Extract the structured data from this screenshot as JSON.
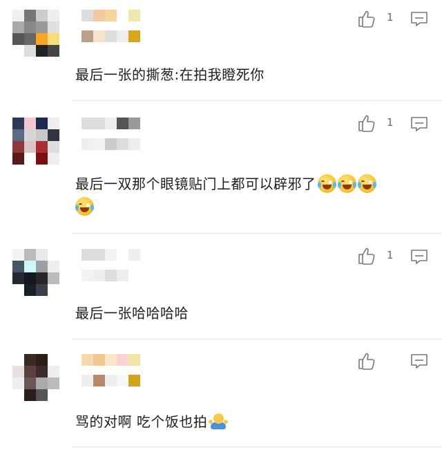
{
  "comments": [
    {
      "text": "最后一张的撕葱:在拍我瞪死你",
      "emoji": [],
      "like_count": "1",
      "like_icon": "thumbs-up-icon",
      "reply_icon": "comment-icon",
      "avatar_colors": [
        "#f0f0f0",
        "#777",
        "#ccc",
        "#eee",
        "#aaa",
        "#888",
        "#999",
        "#e0e0e0",
        "#555",
        "#666",
        "#f5a623",
        "#f9dd7a",
        "#fff",
        "#ddd",
        "#222",
        "#444"
      ],
      "username_colors": [
        "#ddd",
        "#f4c9a1",
        "#f6d49c",
        "#fff",
        "#f1e7a8",
        "#b8a08a",
        "#f7e3c9",
        "#ddd",
        "#eee",
        "#d9a51a"
      ]
    },
    {
      "text": "最后一双那个眼镜贴门上都可以辟邪了",
      "emoji": [
        "laugh-cry-emoji",
        "laugh-cry-emoji",
        "laugh-cry-emoji",
        "laugh-cry-emoji"
      ],
      "like_count": "1",
      "like_icon": "thumbs-up-icon",
      "reply_icon": "comment-icon",
      "avatar_colors": [
        "#2b3a55",
        "#f3c7cf",
        "#1c2b4d",
        "#eee",
        "#5a6b82",
        "#d6d6d6",
        "#c8c8c8",
        "#2e3640",
        "#8c3a3a",
        "#d9c7c7",
        "#a83030",
        "#ddd",
        "#5a1a1a",
        "#fff",
        "#7a1010",
        "#eee"
      ],
      "username_colors": [
        "#ddd",
        "#ddd",
        "#eee",
        "#555",
        "#999",
        "#eee",
        "#f2f2f2",
        "#ccc",
        "#ddd",
        "#eee"
      ]
    },
    {
      "text": "最后一张哈哈哈哈",
      "emoji": [],
      "like_count": "1",
      "like_icon": "thumbs-up-icon",
      "reply_icon": "comment-icon",
      "avatar_colors": [
        "#f4f4f4",
        "#bbb",
        "#e8e8e8",
        "#fff",
        "#456",
        "#cef7f7",
        "#9aa0a6",
        "#eee",
        "#222a33",
        "#111820",
        "#2b2626",
        "#bbb",
        "#fff",
        "#1a1f26",
        "#3a3f48",
        "#fff"
      ],
      "username_colors": [
        "#ddd",
        "#ddd",
        "#f3f3f3",
        "#fff",
        "#eee",
        "#f3f3f3",
        "#eee",
        "#ddd",
        "#eee",
        "#fff"
      ]
    },
    {
      "text": "骂的对啊 吃个饭也拍",
      "emoji": [
        "shrug-emoji"
      ],
      "like_count": "",
      "like_icon": "thumbs-up-icon",
      "reply_icon": "comment-icon",
      "avatar_colors": [
        "#fff",
        "#3a2a22",
        "#2e1e1a",
        "#fff",
        "#e6e0e0",
        "#5a4040",
        "#3d2a2a",
        "#eee",
        "#eee",
        "#6b5555",
        "#aaa",
        "#bbb",
        "#fff",
        "#2a1e1e",
        "#555",
        "#fff"
      ],
      "username_colors": [
        "#f7d9b0",
        "#f2c78f",
        "#f9e5c7",
        "#f9d4d4",
        "#f3e3a5",
        "#eee",
        "#b88a6a",
        "#eee",
        "#f7f7f7",
        "#d4a31c"
      ]
    }
  ]
}
